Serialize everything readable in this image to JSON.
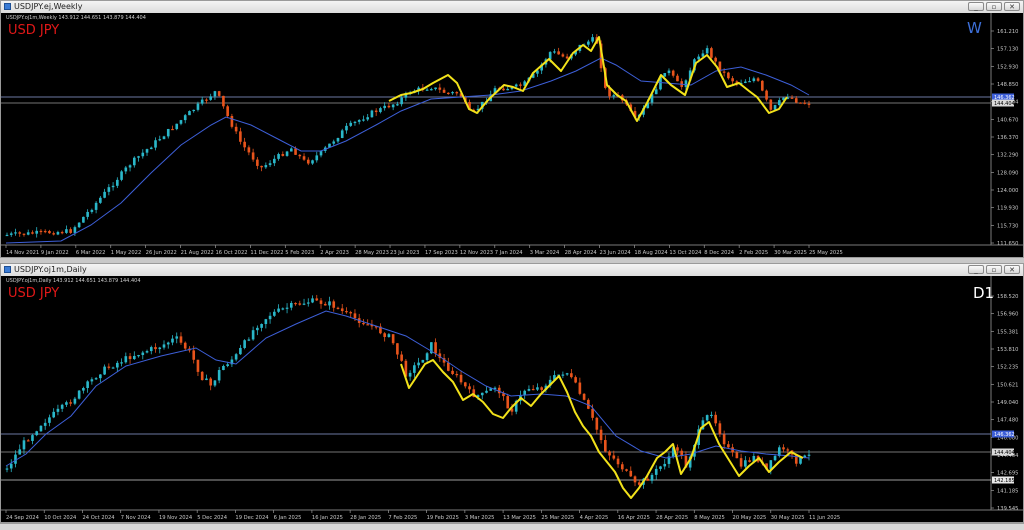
{
  "weekly": {
    "window_title": "USDJPY.ej,Weekly",
    "symbol_info": "USDJPY.oj1m,Weekly  143.912 144.651 143.879 144.404",
    "pair_label": "USD JPY",
    "timeframe": "W",
    "price_labels": [
      "161.210",
      "157.130",
      "152.930",
      "148.850",
      "144.404",
      "140.670",
      "136.370",
      "132.290",
      "128.090",
      "124.000",
      "119.930",
      "115.730",
      "111.650"
    ],
    "highlight_prices": [
      "146.362",
      "144.404"
    ],
    "date_labels": [
      "14 Nov 2021",
      "9 Jan 2022",
      "6 Mar 2022",
      "1 May 2022",
      "26 Jun 2022",
      "21 Aug 2022",
      "16 Oct 2022",
      "11 Dec 2022",
      "5 Feb 2023",
      "2 Apr 2023",
      "28 May 2023",
      "23 Jul 2023",
      "17 Sep 2023",
      "12 Nov 2023",
      "7 Jan 2024",
      "3 Mar 2024",
      "28 Apr 2024",
      "23 Jun 2024",
      "18 Aug 2024",
      "13 Oct 2024",
      "8 Dec 2024",
      "2 Feb 2025",
      "30 Mar 2025",
      "25 May 2025"
    ]
  },
  "daily": {
    "window_title": "USDJPY.oj1m,Daily",
    "symbol_info": "USDJPY.oj1m,Daily  143.912 144.651 143.879 144.404",
    "pair_label": "USD JPY",
    "timeframe": "D1",
    "price_labels": [
      "158.520",
      "156.960",
      "155.381",
      "153.810",
      "152.235",
      "150.621",
      "149.040",
      "147.480",
      "146.080",
      "144.404",
      "142.695",
      "141.185",
      "139.545"
    ],
    "highlight_prices": [
      "146.362",
      "144.404",
      "142.185"
    ],
    "date_labels": [
      "24 Sep 2024",
      "10 Oct 2024",
      "24 Oct 2024",
      "7 Nov 2024",
      "19 Nov 2024",
      "5 Dec 2024",
      "19 Dec 2024",
      "6 Jan 2025",
      "16 Jan 2025",
      "28 Jan 2025",
      "7 Feb 2025",
      "19 Feb 2025",
      "3 Mar 2025",
      "13 Mar 2025",
      "25 Mar 2025",
      "4 Apr 2025",
      "16 Apr 2025",
      "28 Apr 2025",
      "8 May 2025",
      "20 May 2025",
      "30 May 2025",
      "11 Jun 2025"
    ]
  },
  "colors": {
    "background": "#000000",
    "bull_candle": "#2ab7c9",
    "bear_candle": "#e8541c",
    "moving_average": "#3d5fd8",
    "zigzag": "#f2e21a",
    "level_line": "#7f9ad6",
    "axis_text": "#c8c8c8"
  },
  "icons": {
    "window_minimize": "minimize-icon",
    "window_restore": "restore-icon",
    "window_close": "close-icon"
  }
}
